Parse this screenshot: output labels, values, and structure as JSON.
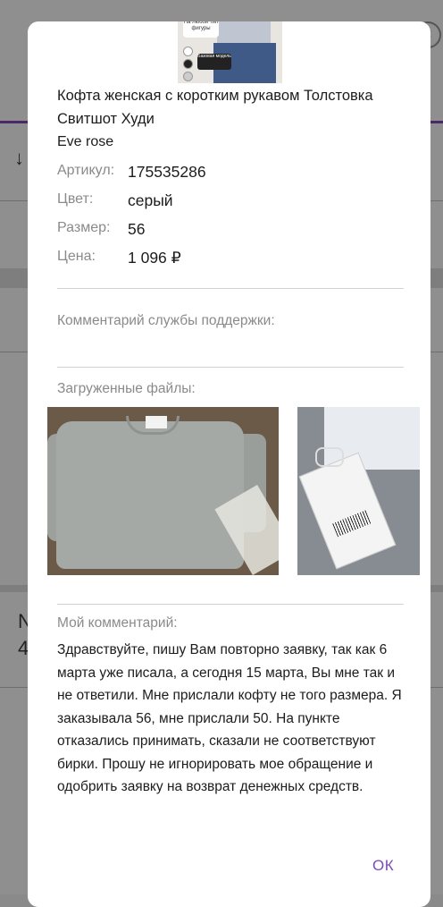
{
  "product": {
    "title": "Кофта женская с коротким рукавом Толстовка Свитшот Худи",
    "brand": "Eve rose",
    "thumbnail_tag_top": "На любой тип фигуры",
    "thumbnail_tag_bottom": "Базовая модель",
    "details": [
      {
        "label": "Артикул:",
        "value": "175535286"
      },
      {
        "label": "Цвет:",
        "value": "серый"
      },
      {
        "label": "Размер:",
        "value": "56"
      },
      {
        "label": "Цена:",
        "value": "1 096 ₽"
      }
    ]
  },
  "support": {
    "label": "Комментарий службы поддержки:",
    "text": ""
  },
  "files": {
    "label": "Загруженные файлы:"
  },
  "my_comment": {
    "label": "Мой комментарий:",
    "text": "Здравствуйте, пишу Вам повторно заявку, так как 6 марта уже писала, а сегодня 15 марта, Вы мне так и не ответили. Мне прислали кофту не того размера. Я заказывала 56, мне прислали 50. На пункте отказались принимать, сказали не соответствуют бирки. Прошу не игнорировать мое обращение и одобрить заявку на возврат денежных средств."
  },
  "actions": {
    "ok_label": "ОК"
  },
  "background": {
    "left_glyph_1": "↓",
    "left_glyph_2": "N",
    "left_glyph_3": "4"
  },
  "colors": {
    "accent": "#7b4bb5",
    "overlay": "#8f8f8f",
    "modal_bg": "#ffffff",
    "muted_text": "#8a8a8a"
  }
}
